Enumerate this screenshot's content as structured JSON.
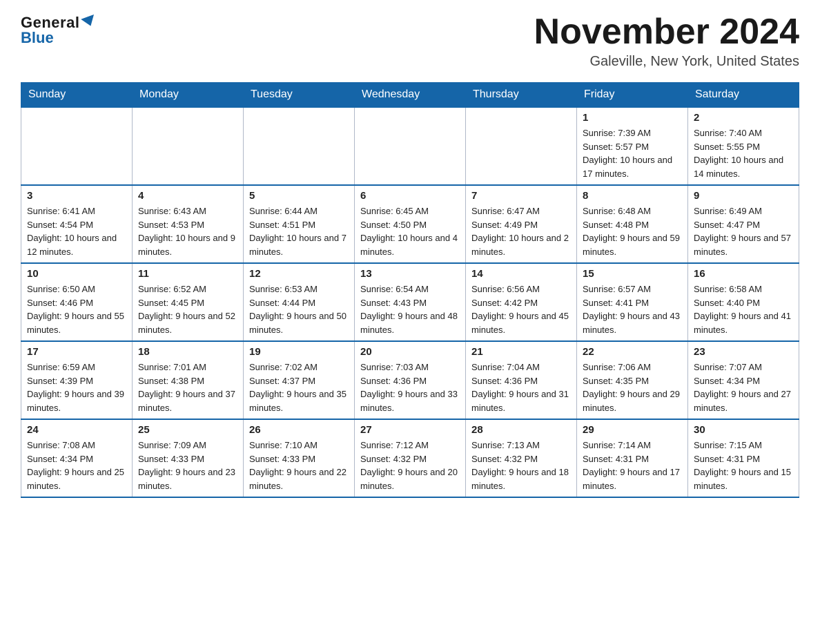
{
  "header": {
    "logo_general": "General",
    "logo_blue": "Blue",
    "month_title": "November 2024",
    "location": "Galeville, New York, United States"
  },
  "weekdays": [
    "Sunday",
    "Monday",
    "Tuesday",
    "Wednesday",
    "Thursday",
    "Friday",
    "Saturday"
  ],
  "weeks": [
    [
      {
        "day": "",
        "info": ""
      },
      {
        "day": "",
        "info": ""
      },
      {
        "day": "",
        "info": ""
      },
      {
        "day": "",
        "info": ""
      },
      {
        "day": "",
        "info": ""
      },
      {
        "day": "1",
        "info": "Sunrise: 7:39 AM\nSunset: 5:57 PM\nDaylight: 10 hours and 17 minutes."
      },
      {
        "day": "2",
        "info": "Sunrise: 7:40 AM\nSunset: 5:55 PM\nDaylight: 10 hours and 14 minutes."
      }
    ],
    [
      {
        "day": "3",
        "info": "Sunrise: 6:41 AM\nSunset: 4:54 PM\nDaylight: 10 hours and 12 minutes."
      },
      {
        "day": "4",
        "info": "Sunrise: 6:43 AM\nSunset: 4:53 PM\nDaylight: 10 hours and 9 minutes."
      },
      {
        "day": "5",
        "info": "Sunrise: 6:44 AM\nSunset: 4:51 PM\nDaylight: 10 hours and 7 minutes."
      },
      {
        "day": "6",
        "info": "Sunrise: 6:45 AM\nSunset: 4:50 PM\nDaylight: 10 hours and 4 minutes."
      },
      {
        "day": "7",
        "info": "Sunrise: 6:47 AM\nSunset: 4:49 PM\nDaylight: 10 hours and 2 minutes."
      },
      {
        "day": "8",
        "info": "Sunrise: 6:48 AM\nSunset: 4:48 PM\nDaylight: 9 hours and 59 minutes."
      },
      {
        "day": "9",
        "info": "Sunrise: 6:49 AM\nSunset: 4:47 PM\nDaylight: 9 hours and 57 minutes."
      }
    ],
    [
      {
        "day": "10",
        "info": "Sunrise: 6:50 AM\nSunset: 4:46 PM\nDaylight: 9 hours and 55 minutes."
      },
      {
        "day": "11",
        "info": "Sunrise: 6:52 AM\nSunset: 4:45 PM\nDaylight: 9 hours and 52 minutes."
      },
      {
        "day": "12",
        "info": "Sunrise: 6:53 AM\nSunset: 4:44 PM\nDaylight: 9 hours and 50 minutes."
      },
      {
        "day": "13",
        "info": "Sunrise: 6:54 AM\nSunset: 4:43 PM\nDaylight: 9 hours and 48 minutes."
      },
      {
        "day": "14",
        "info": "Sunrise: 6:56 AM\nSunset: 4:42 PM\nDaylight: 9 hours and 45 minutes."
      },
      {
        "day": "15",
        "info": "Sunrise: 6:57 AM\nSunset: 4:41 PM\nDaylight: 9 hours and 43 minutes."
      },
      {
        "day": "16",
        "info": "Sunrise: 6:58 AM\nSunset: 4:40 PM\nDaylight: 9 hours and 41 minutes."
      }
    ],
    [
      {
        "day": "17",
        "info": "Sunrise: 6:59 AM\nSunset: 4:39 PM\nDaylight: 9 hours and 39 minutes."
      },
      {
        "day": "18",
        "info": "Sunrise: 7:01 AM\nSunset: 4:38 PM\nDaylight: 9 hours and 37 minutes."
      },
      {
        "day": "19",
        "info": "Sunrise: 7:02 AM\nSunset: 4:37 PM\nDaylight: 9 hours and 35 minutes."
      },
      {
        "day": "20",
        "info": "Sunrise: 7:03 AM\nSunset: 4:36 PM\nDaylight: 9 hours and 33 minutes."
      },
      {
        "day": "21",
        "info": "Sunrise: 7:04 AM\nSunset: 4:36 PM\nDaylight: 9 hours and 31 minutes."
      },
      {
        "day": "22",
        "info": "Sunrise: 7:06 AM\nSunset: 4:35 PM\nDaylight: 9 hours and 29 minutes."
      },
      {
        "day": "23",
        "info": "Sunrise: 7:07 AM\nSunset: 4:34 PM\nDaylight: 9 hours and 27 minutes."
      }
    ],
    [
      {
        "day": "24",
        "info": "Sunrise: 7:08 AM\nSunset: 4:34 PM\nDaylight: 9 hours and 25 minutes."
      },
      {
        "day": "25",
        "info": "Sunrise: 7:09 AM\nSunset: 4:33 PM\nDaylight: 9 hours and 23 minutes."
      },
      {
        "day": "26",
        "info": "Sunrise: 7:10 AM\nSunset: 4:33 PM\nDaylight: 9 hours and 22 minutes."
      },
      {
        "day": "27",
        "info": "Sunrise: 7:12 AM\nSunset: 4:32 PM\nDaylight: 9 hours and 20 minutes."
      },
      {
        "day": "28",
        "info": "Sunrise: 7:13 AM\nSunset: 4:32 PM\nDaylight: 9 hours and 18 minutes."
      },
      {
        "day": "29",
        "info": "Sunrise: 7:14 AM\nSunset: 4:31 PM\nDaylight: 9 hours and 17 minutes."
      },
      {
        "day": "30",
        "info": "Sunrise: 7:15 AM\nSunset: 4:31 PM\nDaylight: 9 hours and 15 minutes."
      }
    ]
  ]
}
